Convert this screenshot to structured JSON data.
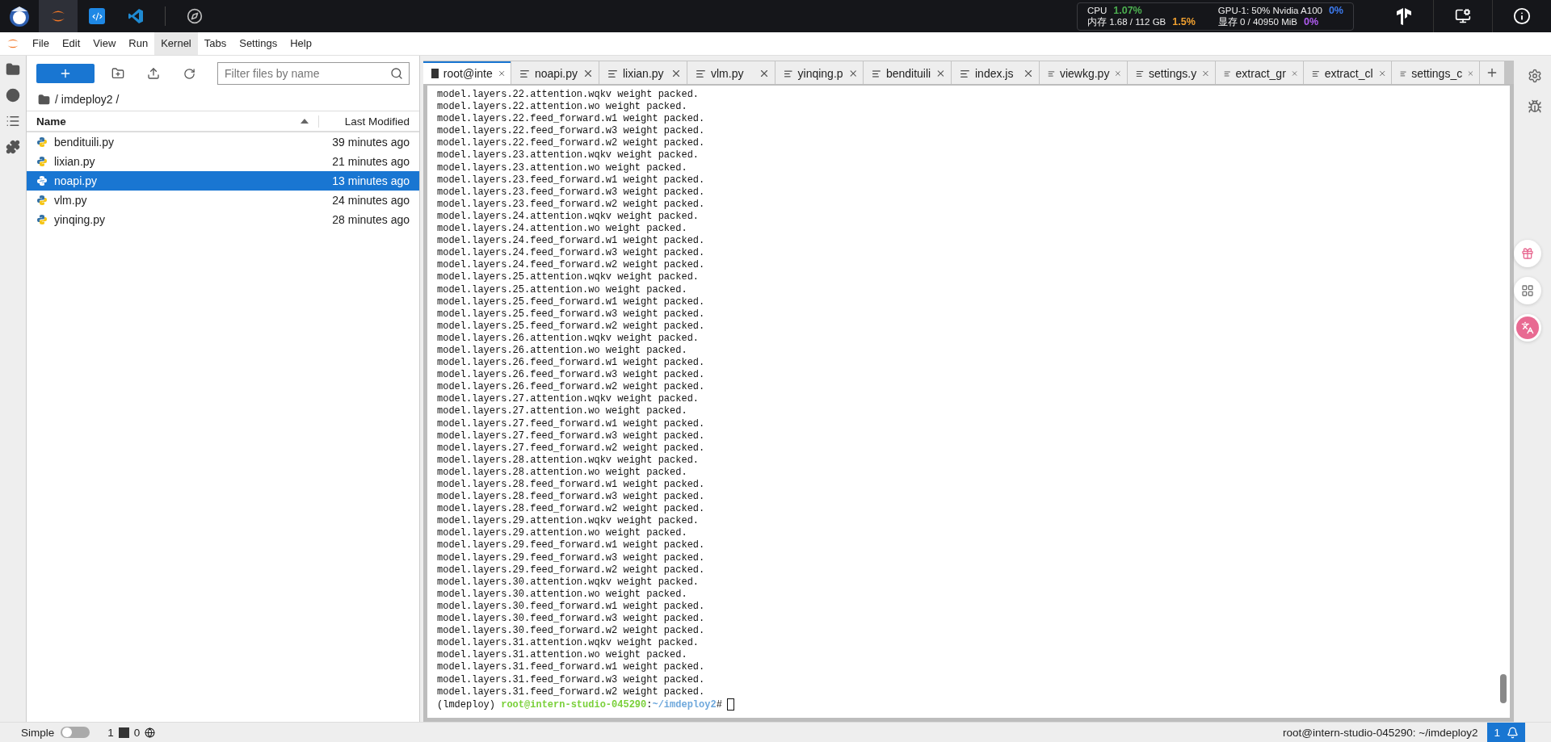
{
  "top_bar": {
    "apps": [
      {
        "kind": "mascot",
        "selected": false
      },
      {
        "kind": "jupyter",
        "selected": true
      },
      {
        "kind": "code",
        "selected": false
      },
      {
        "kind": "vscode",
        "selected": false
      },
      {
        "kind": "compass",
        "selected": false
      }
    ],
    "stats": [
      {
        "label": "CPU",
        "value": "1.07%",
        "color": "#4caf50"
      },
      {
        "label": "GPU-1: 50% Nvidia A100",
        "value": "0%",
        "color": "#3d7bf0"
      },
      {
        "label": "内存 1.68 / 112 GB",
        "value": "1.5%",
        "color": "#f0a030"
      },
      {
        "label": "显存 0 / 40950 MiB",
        "value": "0%",
        "color": "#b05cf0"
      }
    ]
  },
  "menu": [
    {
      "label": "File",
      "selected": false
    },
    {
      "label": "Edit",
      "selected": false
    },
    {
      "label": "View",
      "selected": false
    },
    {
      "label": "Run",
      "selected": false
    },
    {
      "label": "Kernel",
      "selected": true
    },
    {
      "label": "Tabs",
      "selected": false
    },
    {
      "label": "Settings",
      "selected": false
    },
    {
      "label": "Help",
      "selected": false
    }
  ],
  "file_browser": {
    "filter_placeholder": "Filter files by name",
    "path": "/ imdeploy2 /",
    "columns": [
      "Name",
      "Last Modified"
    ],
    "files": [
      {
        "name": "bendituili.py",
        "modified": "39 minutes ago",
        "selected": false
      },
      {
        "name": "lixian.py",
        "modified": "21 minutes ago",
        "selected": false
      },
      {
        "name": "noapi.py",
        "modified": "13 minutes ago",
        "selected": true
      },
      {
        "name": "vlm.py",
        "modified": "24 minutes ago",
        "selected": false
      },
      {
        "name": "yinqing.py",
        "modified": "28 minutes ago",
        "selected": false
      }
    ]
  },
  "tabs": [
    {
      "label": "root@inte",
      "kind": "terminal",
      "selected": true
    },
    {
      "label": "noapi.py",
      "kind": "file",
      "selected": false
    },
    {
      "label": "lixian.py",
      "kind": "file",
      "selected": false
    },
    {
      "label": "vlm.py",
      "kind": "file",
      "selected": false
    },
    {
      "label": "yinqing.p",
      "kind": "file",
      "selected": false
    },
    {
      "label": "bendituili",
      "kind": "file",
      "selected": false
    },
    {
      "label": "index.js",
      "kind": "file",
      "selected": false
    },
    {
      "label": "viewkg.py",
      "kind": "file",
      "selected": false
    },
    {
      "label": "settings.y",
      "kind": "file",
      "selected": false
    },
    {
      "label": "extract_gr",
      "kind": "file",
      "selected": false
    },
    {
      "label": "extract_cl",
      "kind": "file",
      "selected": false
    },
    {
      "label": "settings_c",
      "kind": "file",
      "selected": false
    }
  ],
  "terminal": {
    "lines": [
      "model.layers.22.attention.wqkv weight packed.",
      "model.layers.22.attention.wo weight packed.",
      "model.layers.22.feed_forward.w1 weight packed.",
      "model.layers.22.feed_forward.w3 weight packed.",
      "model.layers.22.feed_forward.w2 weight packed.",
      "model.layers.23.attention.wqkv weight packed.",
      "model.layers.23.attention.wo weight packed.",
      "model.layers.23.feed_forward.w1 weight packed.",
      "model.layers.23.feed_forward.w3 weight packed.",
      "model.layers.23.feed_forward.w2 weight packed.",
      "model.layers.24.attention.wqkv weight packed.",
      "model.layers.24.attention.wo weight packed.",
      "model.layers.24.feed_forward.w1 weight packed.",
      "model.layers.24.feed_forward.w3 weight packed.",
      "model.layers.24.feed_forward.w2 weight packed.",
      "model.layers.25.attention.wqkv weight packed.",
      "model.layers.25.attention.wo weight packed.",
      "model.layers.25.feed_forward.w1 weight packed.",
      "model.layers.25.feed_forward.w3 weight packed.",
      "model.layers.25.feed_forward.w2 weight packed.",
      "model.layers.26.attention.wqkv weight packed.",
      "model.layers.26.attention.wo weight packed.",
      "model.layers.26.feed_forward.w1 weight packed.",
      "model.layers.26.feed_forward.w3 weight packed.",
      "model.layers.26.feed_forward.w2 weight packed.",
      "model.layers.27.attention.wqkv weight packed.",
      "model.layers.27.attention.wo weight packed.",
      "model.layers.27.feed_forward.w1 weight packed.",
      "model.layers.27.feed_forward.w3 weight packed.",
      "model.layers.27.feed_forward.w2 weight packed.",
      "model.layers.28.attention.wqkv weight packed.",
      "model.layers.28.attention.wo weight packed.",
      "model.layers.28.feed_forward.w1 weight packed.",
      "model.layers.28.feed_forward.w3 weight packed.",
      "model.layers.28.feed_forward.w2 weight packed.",
      "model.layers.29.attention.wqkv weight packed.",
      "model.layers.29.attention.wo weight packed.",
      "model.layers.29.feed_forward.w1 weight packed.",
      "model.layers.29.feed_forward.w3 weight packed.",
      "model.layers.29.feed_forward.w2 weight packed.",
      "model.layers.30.attention.wqkv weight packed.",
      "model.layers.30.attention.wo weight packed.",
      "model.layers.30.feed_forward.w1 weight packed.",
      "model.layers.30.feed_forward.w3 weight packed.",
      "model.layers.30.feed_forward.w2 weight packed.",
      "model.layers.31.attention.wqkv weight packed.",
      "model.layers.31.attention.wo weight packed.",
      "model.layers.31.feed_forward.w1 weight packed.",
      "model.layers.31.feed_forward.w3 weight packed.",
      "model.layers.31.feed_forward.w2 weight packed."
    ],
    "prompt": {
      "env": "(lmdeploy)",
      "user": "root@intern-studio-045290",
      "separator": ":",
      "path": "~/imdeploy2",
      "symbol": "#"
    }
  },
  "status_bar": {
    "mode_label": "Simple",
    "simple_mode": false,
    "terminals": "1",
    "kernels": "0",
    "location": "root@intern-studio-045290: ~/imdeploy2",
    "notifications": "1"
  }
}
